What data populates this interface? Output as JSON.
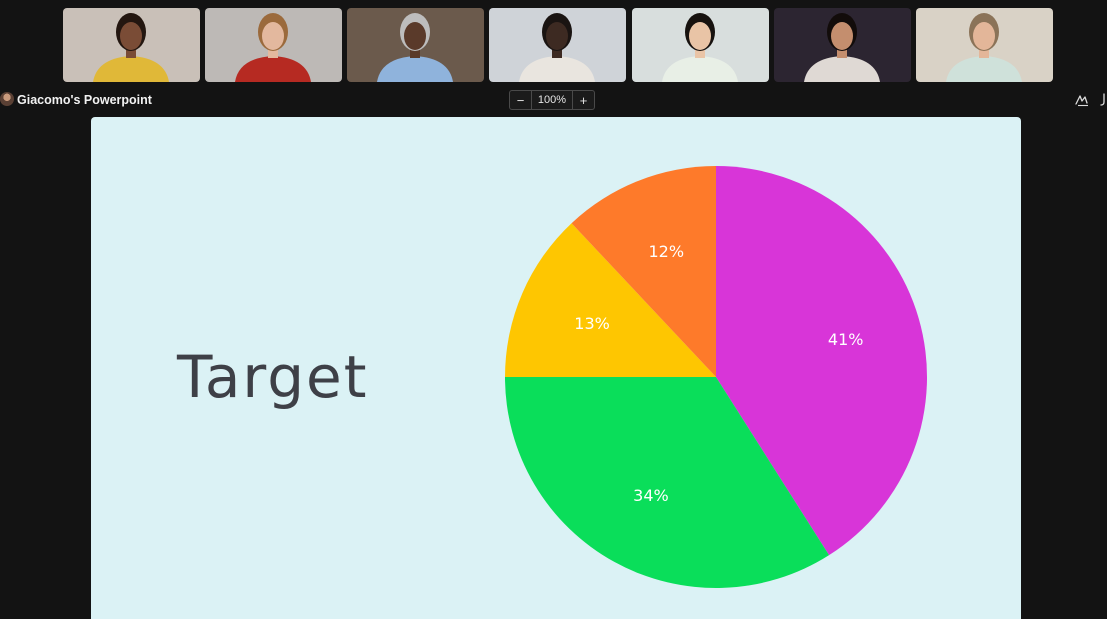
{
  "participants": [
    {
      "name_icon": "participant-video",
      "bg": "#c9c0b8",
      "shirt": "#e0b838",
      "skin": "#7a4c36",
      "hair": "#231610"
    },
    {
      "name_icon": "participant-video",
      "bg": "#bdb9b6",
      "shirt": "#b62a22",
      "skin": "#e3b89e",
      "hair": "#9b6a3c"
    },
    {
      "name_icon": "participant-video",
      "bg": "#6b5a4c",
      "shirt": "#8fb3dc",
      "skin": "#5a3a2a",
      "hair": "#bdbdbd"
    },
    {
      "name_icon": "participant-video",
      "bg": "#cfd3d8",
      "shirt": "#e9e5df",
      "skin": "#3d2a22",
      "hair": "#1a1412"
    },
    {
      "name_icon": "participant-video",
      "bg": "#d8dedd",
      "shirt": "#e8efe6",
      "skin": "#e9c4a6",
      "hair": "#17120f"
    },
    {
      "name_icon": "participant-video",
      "bg": "#2c2531",
      "shirt": "#dfd9d4",
      "skin": "#c48e6e",
      "hair": "#120c0a"
    },
    {
      "name_icon": "participant-video",
      "bg": "#d9d2c6",
      "shirt": "#cfe1da",
      "skin": "#e3b699",
      "hair": "#8b7358"
    }
  ],
  "share": {
    "title": "Giacomo's Powerpoint",
    "zoom_out_label": "−",
    "zoom_level": "100%",
    "zoom_in_label": "+"
  },
  "slide": {
    "title": "Target"
  },
  "chart_data": {
    "type": "pie",
    "title": "",
    "slices": [
      {
        "label": "41%",
        "value": 41,
        "color": "#d835d8"
      },
      {
        "label": "34%",
        "value": 34,
        "color": "#0ade5a"
      },
      {
        "label": "13%",
        "value": 13,
        "color": "#fec601"
      },
      {
        "label": "12%",
        "value": 12,
        "color": "#fe7a2a"
      }
    ],
    "start": "12 o'clock",
    "direction": "clockwise",
    "label_color": "#ffffff"
  }
}
